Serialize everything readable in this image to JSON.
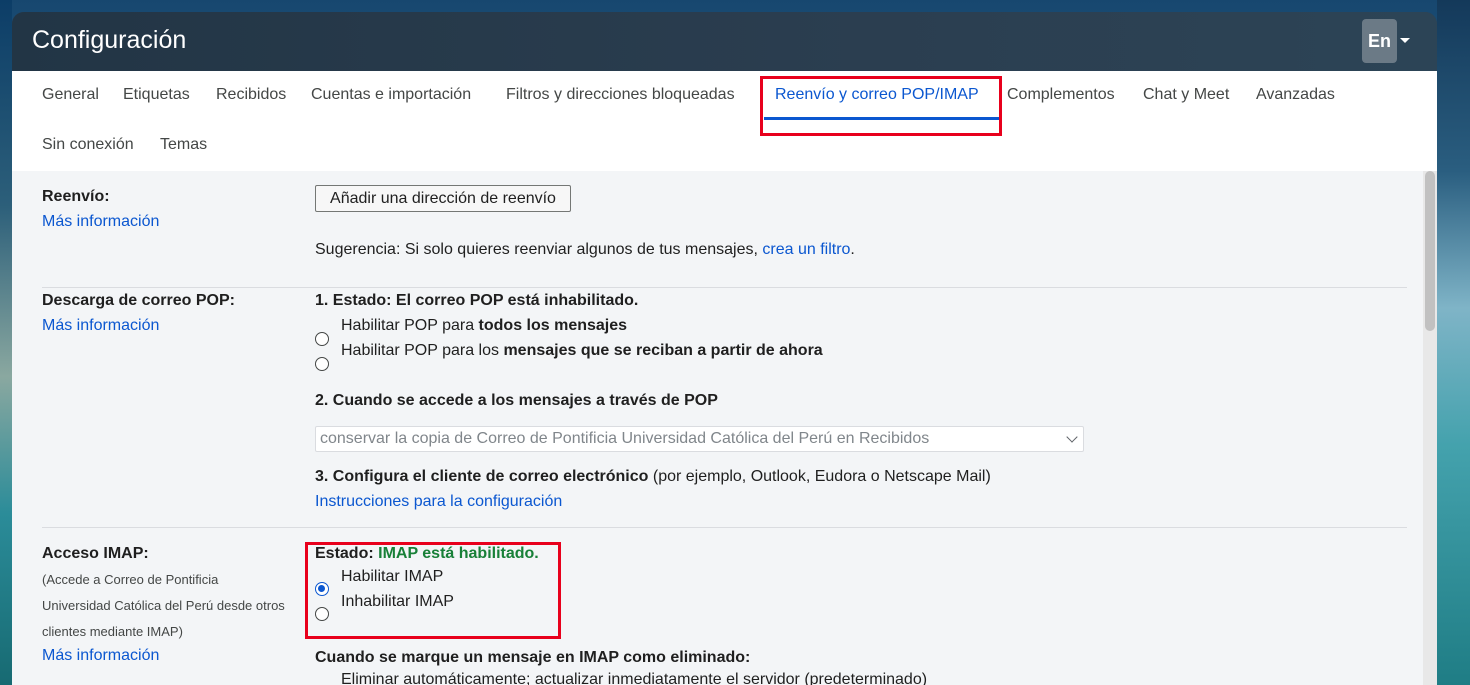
{
  "title": "Configuración",
  "lang_button": "En",
  "tabs": [
    {
      "label": "General"
    },
    {
      "label": "Etiquetas"
    },
    {
      "label": "Recibidos"
    },
    {
      "label": "Cuentas e importación"
    },
    {
      "label": "Filtros y direcciones bloqueadas"
    },
    {
      "label": "Reenvío y correo POP/IMAP",
      "active": true
    },
    {
      "label": "Complementos"
    },
    {
      "label": "Chat y Meet"
    },
    {
      "label": "Avanzadas"
    },
    {
      "label": "Sin conexión"
    },
    {
      "label": "Temas"
    }
  ],
  "forwarding": {
    "label": "Reenvío:",
    "more_info": "Más información",
    "add_button": "Añadir una dirección de reenvío",
    "tip_prefix": "Sugerencia: Si solo quieres reenviar algunos de tus mensajes, ",
    "tip_link": "crea un filtro",
    "tip_suffix": "."
  },
  "pop": {
    "label": "Descarga de correo POP:",
    "more_info": "Más información",
    "status": "1. Estado: El correo POP está inhabilitado.",
    "option1_prefix": "Habilitar POP para ",
    "option1_bold": "todos los mensajes",
    "option2_prefix": "Habilitar POP para los ",
    "option2_bold": "mensajes que se reciban a partir de ahora",
    "when_access": "2. Cuando se accede a los mensajes a través de POP",
    "select_value": "conservar la copia de Correo de Pontificia Universidad Católica del Perú en Recibidos",
    "configure_bold": "3. Configura el cliente de correo electrónico",
    "configure_rest": " (por ejemplo, Outlook, Eudora o Netscape Mail)",
    "instructions": "Instrucciones para la configuración"
  },
  "imap": {
    "label": "Acceso IMAP:",
    "desc_line1": "(Accede a Correo de Pontificia",
    "desc_line2": "Universidad Católica del Perú desde otros",
    "desc_line3": "clientes mediante IMAP)",
    "more_info": "Más información",
    "status_prefix": "Estado: ",
    "status_value": "IMAP está habilitado.",
    "enable": "Habilitar IMAP",
    "disable": "Inhabilitar IMAP",
    "enabled": true,
    "deleted_heading": "Cuando se marque un mensaje en IMAP como eliminado:",
    "auto_expunge": "Eliminar automáticamente; actualizar inmediatamente el servidor (predeterminado)"
  },
  "colors": {
    "accent": "#0b57d0",
    "highlight": "#e8001c",
    "status_green": "#188038",
    "header_bg": "#2b3e50"
  }
}
